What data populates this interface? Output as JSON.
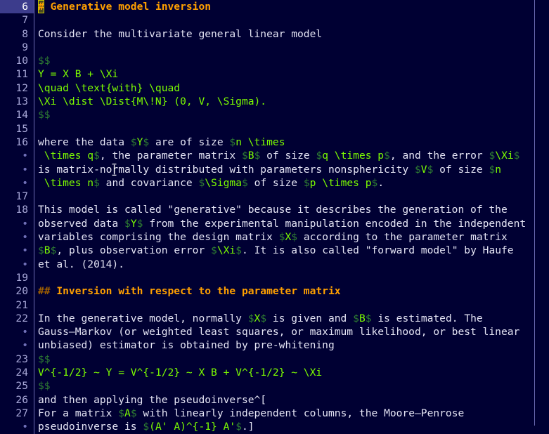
{
  "editor": {
    "app": "vim-markdown-editor",
    "colors": {
      "background": "#000033",
      "foreground": "#e4e4f4",
      "gutter_fg": "#a8a8d8",
      "gutter_wrap_fg": "#7070b8",
      "current_line_bg": "#3c3c8c",
      "separator": "#6a6ab0",
      "column_guide": "#6a6ab0",
      "heading": "#ffa000",
      "heading_marker": "#a06000",
      "math_delimiter": "#2e7d32",
      "math_content": "#7cfc00",
      "cursor_bg": "#4a4a20",
      "cursor_border": "#c8c800"
    },
    "wrap_marker": "•",
    "column_guide_column": 80,
    "cursor": {
      "line": 6,
      "column": 1,
      "char": "#"
    },
    "lines": [
      {
        "number": "6",
        "kind": "number",
        "current": true,
        "tokens": [
          {
            "t": "#",
            "c": "headmark",
            "cursor": true
          },
          {
            "t": " Generative model inversion",
            "c": "head"
          }
        ]
      },
      {
        "number": "7",
        "kind": "number",
        "tokens": []
      },
      {
        "number": "8",
        "kind": "number",
        "tokens": [
          {
            "t": "Consider the multivariate general linear model",
            "c": "text"
          }
        ]
      },
      {
        "number": "9",
        "kind": "number",
        "tokens": []
      },
      {
        "number": "10",
        "kind": "number",
        "tokens": [
          {
            "t": "$$",
            "c": "delim"
          }
        ]
      },
      {
        "number": "11",
        "kind": "number",
        "tokens": [
          {
            "t": "Y = X B + \\Xi",
            "c": "math"
          }
        ]
      },
      {
        "number": "12",
        "kind": "number",
        "tokens": [
          {
            "t": "\\quad \\text{with} \\quad",
            "c": "math"
          }
        ]
      },
      {
        "number": "13",
        "kind": "number",
        "tokens": [
          {
            "t": "\\Xi \\dist \\Dist{M\\!N} (0, V, \\Sigma).",
            "c": "math"
          }
        ]
      },
      {
        "number": "14",
        "kind": "number",
        "tokens": [
          {
            "t": "$$",
            "c": "delim"
          }
        ]
      },
      {
        "number": "15",
        "kind": "number",
        "tokens": []
      },
      {
        "number": "16",
        "kind": "number",
        "tokens": [
          {
            "t": "where the data ",
            "c": "text"
          },
          {
            "t": "$",
            "c": "delim"
          },
          {
            "t": "Y",
            "c": "math"
          },
          {
            "t": "$",
            "c": "delim"
          },
          {
            "t": " are of size ",
            "c": "text"
          },
          {
            "t": "$",
            "c": "delim"
          },
          {
            "t": "n \\times",
            "c": "math"
          }
        ]
      },
      {
        "number": "•",
        "kind": "wrap",
        "tokens": [
          {
            "t": " \\times q",
            "c": "math"
          },
          {
            "t": "$",
            "c": "delim"
          },
          {
            "t": ", the parameter matrix ",
            "c": "text"
          },
          {
            "t": "$",
            "c": "delim"
          },
          {
            "t": "B",
            "c": "math"
          },
          {
            "t": "$",
            "c": "delim"
          },
          {
            "t": " of size ",
            "c": "text"
          },
          {
            "t": "$",
            "c": "delim"
          },
          {
            "t": "q \\times p",
            "c": "math"
          },
          {
            "t": "$",
            "c": "delim"
          },
          {
            "t": ", and the error ",
            "c": "text"
          },
          {
            "t": "$",
            "c": "delim"
          },
          {
            "t": "\\Xi",
            "c": "math"
          },
          {
            "t": "$",
            "c": "delim"
          }
        ]
      },
      {
        "number": "•",
        "kind": "wrap",
        "tokens": [
          {
            "t": "is matrix-normally distributed with parameters nonsphericity ",
            "c": "text"
          },
          {
            "t": "$",
            "c": "delim"
          },
          {
            "t": "V",
            "c": "math"
          },
          {
            "t": "$",
            "c": "delim"
          },
          {
            "t": " of size ",
            "c": "text"
          },
          {
            "t": "$",
            "c": "delim"
          },
          {
            "t": "n",
            "c": "math"
          }
        ]
      },
      {
        "number": "•",
        "kind": "wrap",
        "tokens": [
          {
            "t": " \\times n",
            "c": "math"
          },
          {
            "t": "$",
            "c": "delim"
          },
          {
            "t": " and covariance ",
            "c": "text"
          },
          {
            "t": "$",
            "c": "delim"
          },
          {
            "t": "\\Sigma",
            "c": "math"
          },
          {
            "t": "$",
            "c": "delim"
          },
          {
            "t": " of size ",
            "c": "text"
          },
          {
            "t": "$",
            "c": "delim"
          },
          {
            "t": "p \\times p",
            "c": "math"
          },
          {
            "t": "$",
            "c": "delim"
          },
          {
            "t": ".",
            "c": "text"
          }
        ]
      },
      {
        "number": "17",
        "kind": "number",
        "tokens": []
      },
      {
        "number": "18",
        "kind": "number",
        "tokens": [
          {
            "t": "This model is called \"generative\" because it describes the generation of the",
            "c": "text"
          }
        ]
      },
      {
        "number": "•",
        "kind": "wrap",
        "tokens": [
          {
            "t": "observed data ",
            "c": "text"
          },
          {
            "t": "$",
            "c": "delim"
          },
          {
            "t": "Y",
            "c": "math"
          },
          {
            "t": "$",
            "c": "delim"
          },
          {
            "t": " from the experimental manipulation encoded in the independent",
            "c": "text"
          }
        ]
      },
      {
        "number": "•",
        "kind": "wrap",
        "tokens": [
          {
            "t": "variables comprising the design matrix ",
            "c": "text"
          },
          {
            "t": "$",
            "c": "delim"
          },
          {
            "t": "X",
            "c": "math"
          },
          {
            "t": "$",
            "c": "delim"
          },
          {
            "t": " according to the parameter matrix",
            "c": "text"
          }
        ]
      },
      {
        "number": "•",
        "kind": "wrap",
        "tokens": [
          {
            "t": "$",
            "c": "delim"
          },
          {
            "t": "B",
            "c": "math"
          },
          {
            "t": "$",
            "c": "delim"
          },
          {
            "t": ", plus observation error ",
            "c": "text"
          },
          {
            "t": "$",
            "c": "delim"
          },
          {
            "t": "\\Xi",
            "c": "math"
          },
          {
            "t": "$",
            "c": "delim"
          },
          {
            "t": ". It is also called \"forward model\" by Haufe",
            "c": "text"
          }
        ]
      },
      {
        "number": "•",
        "kind": "wrap",
        "tokens": [
          {
            "t": "et al. (2014).",
            "c": "text"
          }
        ]
      },
      {
        "number": "19",
        "kind": "number",
        "tokens": []
      },
      {
        "number": "20",
        "kind": "number",
        "tokens": [
          {
            "t": "##",
            "c": "headmark"
          },
          {
            "t": " Inversion with respect to the parameter matrix",
            "c": "head"
          }
        ]
      },
      {
        "number": "21",
        "kind": "number",
        "tokens": []
      },
      {
        "number": "22",
        "kind": "number",
        "tokens": [
          {
            "t": "In the generative model, normally ",
            "c": "text"
          },
          {
            "t": "$",
            "c": "delim"
          },
          {
            "t": "X",
            "c": "math"
          },
          {
            "t": "$",
            "c": "delim"
          },
          {
            "t": " is given and ",
            "c": "text"
          },
          {
            "t": "$",
            "c": "delim"
          },
          {
            "t": "B",
            "c": "math"
          },
          {
            "t": "$",
            "c": "delim"
          },
          {
            "t": " is estimated. The",
            "c": "text"
          }
        ]
      },
      {
        "number": "•",
        "kind": "wrap",
        "tokens": [
          {
            "t": "Gauss–Markov (or weighted least squares, or maximum likelihood, or best linear",
            "c": "text"
          }
        ]
      },
      {
        "number": "•",
        "kind": "wrap",
        "tokens": [
          {
            "t": "unbiased) estimator is obtained by pre-whitening",
            "c": "text"
          }
        ]
      },
      {
        "number": "23",
        "kind": "number",
        "tokens": [
          {
            "t": "$$",
            "c": "delim"
          }
        ]
      },
      {
        "number": "24",
        "kind": "number",
        "tokens": [
          {
            "t": "V^{-1/2} ~ Y = V^{-1/2} ~ X B + V^{-1/2} ~ \\Xi",
            "c": "math"
          }
        ]
      },
      {
        "number": "25",
        "kind": "number",
        "tokens": [
          {
            "t": "$$",
            "c": "delim"
          }
        ]
      },
      {
        "number": "26",
        "kind": "number",
        "tokens": [
          {
            "t": "and then applying the pseudoinverse^[",
            "c": "text"
          }
        ]
      },
      {
        "number": "27",
        "kind": "number",
        "tokens": [
          {
            "t": "For a matrix ",
            "c": "text"
          },
          {
            "t": "$",
            "c": "delim"
          },
          {
            "t": "A",
            "c": "math"
          },
          {
            "t": "$",
            "c": "delim"
          },
          {
            "t": " with linearly independent columns, the Moore–Penrose",
            "c": "text"
          }
        ]
      },
      {
        "number": "•",
        "kind": "wrap",
        "tokens": [
          {
            "t": "pseudoinverse is ",
            "c": "text"
          },
          {
            "t": "$",
            "c": "delim"
          },
          {
            "t": "(A' A)^{-1} A'",
            "c": "math"
          },
          {
            "t": "$",
            "c": "delim"
          },
          {
            "t": ".]",
            "c": "text"
          }
        ]
      }
    ]
  }
}
